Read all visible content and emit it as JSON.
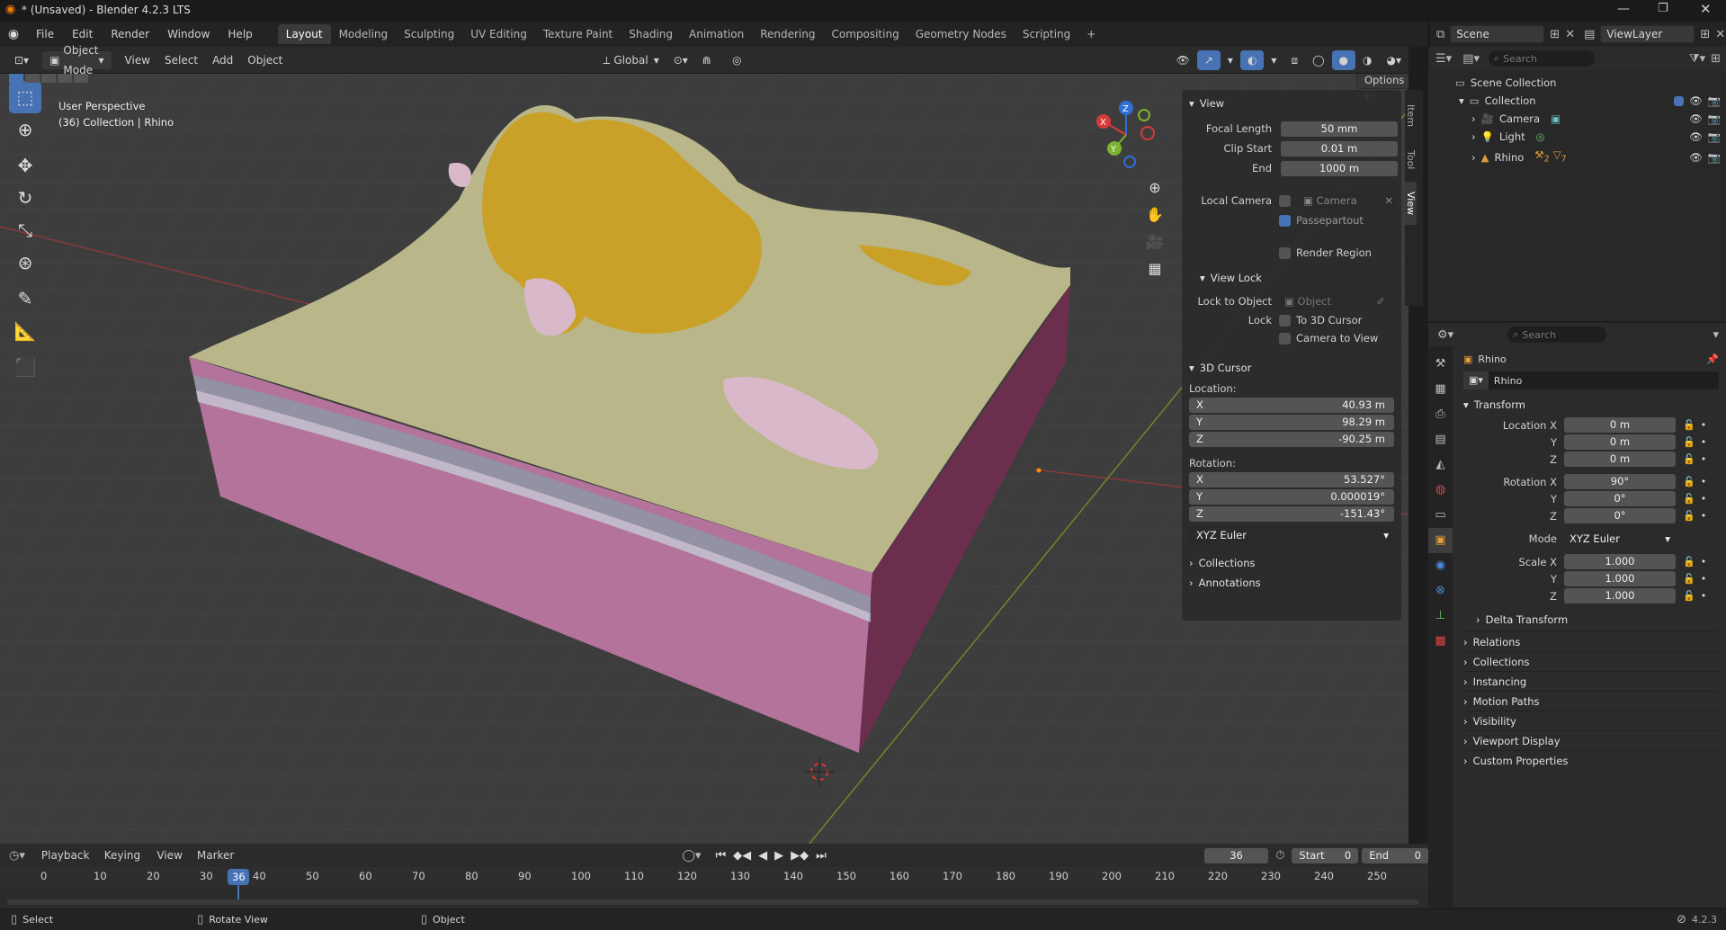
{
  "window": {
    "title": "* (Unsaved) - Blender 4.2.3 LTS"
  },
  "menus": [
    "File",
    "Edit",
    "Render",
    "Window",
    "Help"
  ],
  "workspaces": [
    "Layout",
    "Modeling",
    "Sculpting",
    "UV Editing",
    "Texture Paint",
    "Shading",
    "Animation",
    "Rendering",
    "Compositing",
    "Geometry Nodes",
    "Scripting"
  ],
  "topright": {
    "scene": "Scene",
    "viewlayer": "ViewLayer"
  },
  "vphdr": {
    "mode": "Object Mode",
    "view": "View",
    "select": "Select",
    "add": "Add",
    "object": "Object",
    "orientation": "Global",
    "options": "Options"
  },
  "viewport": {
    "overlay_line1": "User Perspective",
    "overlay_line2": "(36) Collection | Rhino"
  },
  "npanel": {
    "tabs": [
      "Item",
      "Tool",
      "View"
    ],
    "view_header": "View",
    "focal_label": "Focal Length",
    "focal_value": "50 mm",
    "clipstart_label": "Clip Start",
    "clipstart_value": "0.01 m",
    "end_label": "End",
    "end_value": "1000 m",
    "localcam_label": "Local Camera",
    "localcam_value": "Camera",
    "passepartout": "Passepartout",
    "renderregion": "Render Region",
    "viewlock_header": "View Lock",
    "locktoobj_label": "Lock to Object",
    "locktoobj_placeholder": "Object",
    "lock_label": "Lock",
    "lock_cursor": "To 3D Cursor",
    "lock_camera": "Camera to View",
    "cursor_header": "3D Cursor",
    "location_label": "Location:",
    "loc": [
      {
        "axis": "X",
        "value": "40.93 m"
      },
      {
        "axis": "Y",
        "value": "98.29 m"
      },
      {
        "axis": "Z",
        "value": "-90.25 m"
      }
    ],
    "rotation_label": "Rotation:",
    "rot": [
      {
        "axis": "X",
        "value": "53.527°"
      },
      {
        "axis": "Y",
        "value": "0.000019°"
      },
      {
        "axis": "Z",
        "value": "-151.43°"
      }
    ],
    "rotmode": "XYZ Euler",
    "collections": "Collections",
    "annotations": "Annotations"
  },
  "outliner": {
    "search_placeholder": "Search",
    "scene_collection": "Scene Collection",
    "collection": "Collection",
    "items": [
      "Camera",
      "Light",
      "Rhino"
    ],
    "rhino_badges": [
      "2",
      "7"
    ]
  },
  "props": {
    "search_placeholder": "Search",
    "object_name": "Rhino",
    "datablock": "Rhino",
    "transform": "Transform",
    "location_label": "Location X",
    "loc_y": "Y",
    "loc_z": "Z",
    "loc": [
      "0 m",
      "0 m",
      "0 m"
    ],
    "rotation_label": "Rotation X",
    "rot_y": "Y",
    "rot_z": "Z",
    "rot": [
      "90°",
      "0°",
      "0°"
    ],
    "mode_label": "Mode",
    "mode_value": "XYZ Euler",
    "scale_label": "Scale X",
    "scale_y": "Y",
    "scale_z": "Z",
    "scale": [
      "1.000",
      "1.000",
      "1.000"
    ],
    "delta": "Delta Transform",
    "panels": [
      "Relations",
      "Collections",
      "Instancing",
      "Motion Paths",
      "Visibility",
      "Viewport Display",
      "Custom Properties"
    ]
  },
  "timeline": {
    "menus": [
      "Playback",
      "Keying",
      "View",
      "Marker"
    ],
    "current": "36",
    "start_label": "Start",
    "start": "0",
    "end_label": "End",
    "end": "0",
    "ticks": [
      "0",
      "10",
      "20",
      "30",
      "40",
      "50",
      "60",
      "70",
      "80",
      "90",
      "100",
      "110",
      "120",
      "130",
      "140",
      "150",
      "160",
      "170",
      "180",
      "190",
      "200",
      "210",
      "220",
      "230",
      "240",
      "250"
    ],
    "frame_marker": "36"
  },
  "status": {
    "select": "Select",
    "rotate": "Rotate View",
    "object": "Object",
    "version": "4.2.3"
  },
  "colors": {
    "accent": "#4772b3",
    "terrain": "#b9b68a",
    "side": "#b3739a",
    "yellow": "#c9a128",
    "pink": "#d9b9c9"
  }
}
